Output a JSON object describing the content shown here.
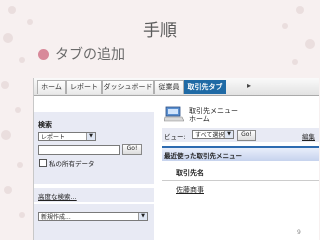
{
  "slide": {
    "title": "手順",
    "bullet": "タブの追加",
    "page_number": "9"
  },
  "colors": {
    "accent_tab": "#1f6aa5",
    "bullet": "#d8899a",
    "panel": "#e8eaf4"
  },
  "tabs": [
    {
      "label": "ホーム",
      "active": false
    },
    {
      "label": "レポート",
      "active": false
    },
    {
      "label": "ダッシュボード",
      "active": false
    },
    {
      "label": "従業員",
      "active": false
    },
    {
      "label": "取引先タブ",
      "active": true
    }
  ],
  "tab_more_icon": "triangle-right-icon",
  "sidebar": {
    "search_label": "検索",
    "search_scope": "レポート",
    "go_label": "Go!",
    "my_data_label": "私の所有データ",
    "advanced_search": "高度な検索...",
    "new_create": "新規作成..."
  },
  "main": {
    "home_icon": "computer-icon",
    "title_line1": "取引先メニュー",
    "title_line2": "ホーム",
    "view_label": "ビュー:",
    "view_value": "すべて選択",
    "view_go": "Go!",
    "edit_label": "編集",
    "recent_title": "最近使った取引先メニュー",
    "column_header": "取引先名",
    "rows": [
      "佐藤商事"
    ]
  }
}
